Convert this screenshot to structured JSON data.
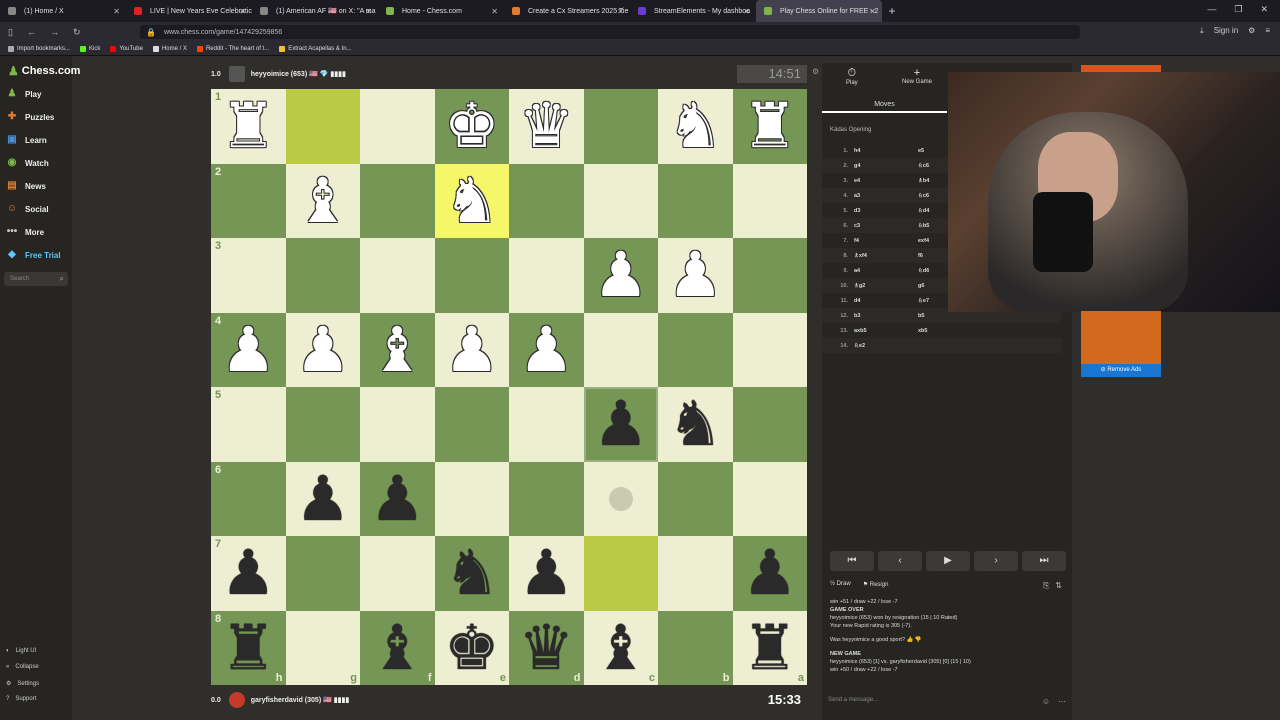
{
  "browser": {
    "tabs": [
      {
        "title": "(1) Home / X",
        "color": "#888",
        "active": false
      },
      {
        "title": "LIVE | New Years Eve Celebratic",
        "color": "#e02020",
        "active": false
      },
      {
        "title": "(1) American AF 🇺🇸 on X: \"A ma",
        "color": "#888",
        "active": false
      },
      {
        "title": "Home - Chess.com",
        "color": "#81b64c",
        "active": false
      },
      {
        "title": "Create a Cx Streamers 2025 Tie",
        "color": "#e07b30",
        "active": false
      },
      {
        "title": "StreamElements - My dashboa",
        "color": "#6a3ad6",
        "active": false
      },
      {
        "title": "Play Chess Online for FREE - 2",
        "color": "#81b64c",
        "active": true
      }
    ],
    "url": "www.chess.com/game/147429259856",
    "sign_in": "Sign in",
    "bookmarks": [
      {
        "label": "Import bookmarks...",
        "color": "#aaa"
      },
      {
        "label": "Kick",
        "color": "#53fc18"
      },
      {
        "label": "YouTube",
        "color": "#ff0000"
      },
      {
        "label": "Home / X",
        "color": "#ddd"
      },
      {
        "label": "Reddit - The heart of t...",
        "color": "#ff4500"
      },
      {
        "label": "Extract Acapellas & In...",
        "color": "#f0c030"
      }
    ]
  },
  "sidebar": {
    "logo": "Chess.com",
    "items": [
      {
        "label": "Play",
        "icon": "play-icon",
        "glyph": "♟",
        "color": "#81b64c"
      },
      {
        "label": "Puzzles",
        "icon": "puzzle-icon",
        "glyph": "✚",
        "color": "#e07b30"
      },
      {
        "label": "Learn",
        "icon": "learn-icon",
        "glyph": "▣",
        "color": "#4a90d9"
      },
      {
        "label": "Watch",
        "icon": "watch-icon",
        "glyph": "◉",
        "color": "#81b64c"
      },
      {
        "label": "News",
        "icon": "news-icon",
        "glyph": "▤",
        "color": "#e07b30"
      },
      {
        "label": "Social",
        "icon": "social-icon",
        "glyph": "☺",
        "color": "#e07b30"
      },
      {
        "label": "More",
        "icon": "more-icon",
        "glyph": "•••",
        "color": "#ccc"
      },
      {
        "label": "Free Trial",
        "icon": "diamond-icon",
        "glyph": "◆",
        "color": "#5ac8fa"
      }
    ],
    "search_placeholder": "Search",
    "bottom": [
      {
        "label": "Light UI",
        "glyph": "◐"
      },
      {
        "label": "Collapse",
        "glyph": "«"
      },
      {
        "label": "Settings",
        "glyph": "⚙"
      },
      {
        "label": "Support",
        "glyph": "?"
      }
    ]
  },
  "game": {
    "top_player": {
      "score": "1.0",
      "name": "heyyoimice (653) 🇺🇸 💎 ▮▮▮▮",
      "clock": "14:51"
    },
    "bottom_player": {
      "score": "0.0",
      "name": "garyfisherdavid (305) 🇺🇸 ▮▮▮▮",
      "clock": "15:33"
    },
    "board": [
      [
        "wR",
        "",
        "",
        "wK",
        "wQ",
        "",
        "wN",
        "wR"
      ],
      [
        "",
        "wB",
        "",
        "wN",
        "",
        "",
        "",
        ""
      ],
      [
        "",
        "",
        "",
        "",
        "",
        "wP",
        "wP",
        ""
      ],
      [
        "wP",
        "wP",
        "wB",
        "wP",
        "wP",
        "",
        "",
        ""
      ],
      [
        "",
        "",
        "",
        "",
        "",
        "bP",
        "bN",
        ""
      ],
      [
        "",
        "bP",
        "bP",
        "",
        "",
        "",
        "",
        ""
      ],
      [
        "bP",
        "",
        "",
        "bN",
        "bP",
        "",
        "",
        "bP"
      ],
      [
        "bR",
        "",
        "bB",
        "bK",
        "bQ",
        "bB",
        "",
        "bR"
      ]
    ],
    "highlights": [
      {
        "row": 0,
        "col": 1,
        "type": "hl"
      },
      {
        "row": 1,
        "col": 3,
        "type": "hly"
      },
      {
        "row": 6,
        "col": 5,
        "type": "hl"
      }
    ],
    "move_dot": {
      "row": 5,
      "col": 5
    },
    "last_move_square": {
      "row": 4,
      "col": 5
    },
    "rank_labels": [
      "1",
      "2",
      "3",
      "4",
      "5",
      "6",
      "7",
      "8"
    ],
    "file_labels": [
      "h",
      "g",
      "f",
      "e",
      "d",
      "c",
      "b",
      "a"
    ]
  },
  "panel": {
    "tabs": [
      {
        "label": "Play",
        "glyph": "⏱"
      },
      {
        "label": "New Game",
        "glyph": "+"
      }
    ],
    "moves_header": "Moves",
    "opening": "Kádas Opening",
    "moves": [
      {
        "n": "1.",
        "w": "h4",
        "b": "e5"
      },
      {
        "n": "2.",
        "w": "g4",
        "b": "♘c6"
      },
      {
        "n": "3.",
        "w": "e4",
        "b": "♗b4"
      },
      {
        "n": "4.",
        "w": "a3",
        "b": "♘c6"
      },
      {
        "n": "5.",
        "w": "d3",
        "b": "♘d4"
      },
      {
        "n": "6.",
        "w": "c3",
        "b": "♘b5"
      },
      {
        "n": "7.",
        "w": "f4",
        "b": "exf4"
      },
      {
        "n": "8.",
        "w": "♗xf4",
        "b": "f6"
      },
      {
        "n": "9.",
        "w": "a4",
        "b": "♘d6"
      },
      {
        "n": "10.",
        "w": "♗g2",
        "b": "g6"
      },
      {
        "n": "11.",
        "w": "d4",
        "b": "♘e7"
      },
      {
        "n": "12.",
        "w": "b3",
        "b": "b5"
      },
      {
        "n": "13.",
        "w": "axb5",
        "b": "xb5"
      },
      {
        "n": "14.",
        "w": "♘e2",
        "b": ""
      }
    ],
    "draw": "Draw",
    "resign": "Resign",
    "stats_line": "win +51 / draw +22 / lose -7",
    "game_over": "GAME OVER",
    "result_line": "heyyoimice (653) won by resignation (15 | 10 Rated)",
    "rating_line": "Your new Rapid rating is 305 (-7).",
    "good_sport": "Was heyyoimice a good sport?",
    "new_game": "NEW GAME",
    "new_game_line": "heyyoimice (653) [1] vs. garyfisherdavid (305) [0] (15 | 10)",
    "stats_line2": "win +50 / draw +22 / lose -7",
    "chat_placeholder": "Send a message..."
  },
  "ads": {
    "remove_ads": "Remove Ads"
  }
}
